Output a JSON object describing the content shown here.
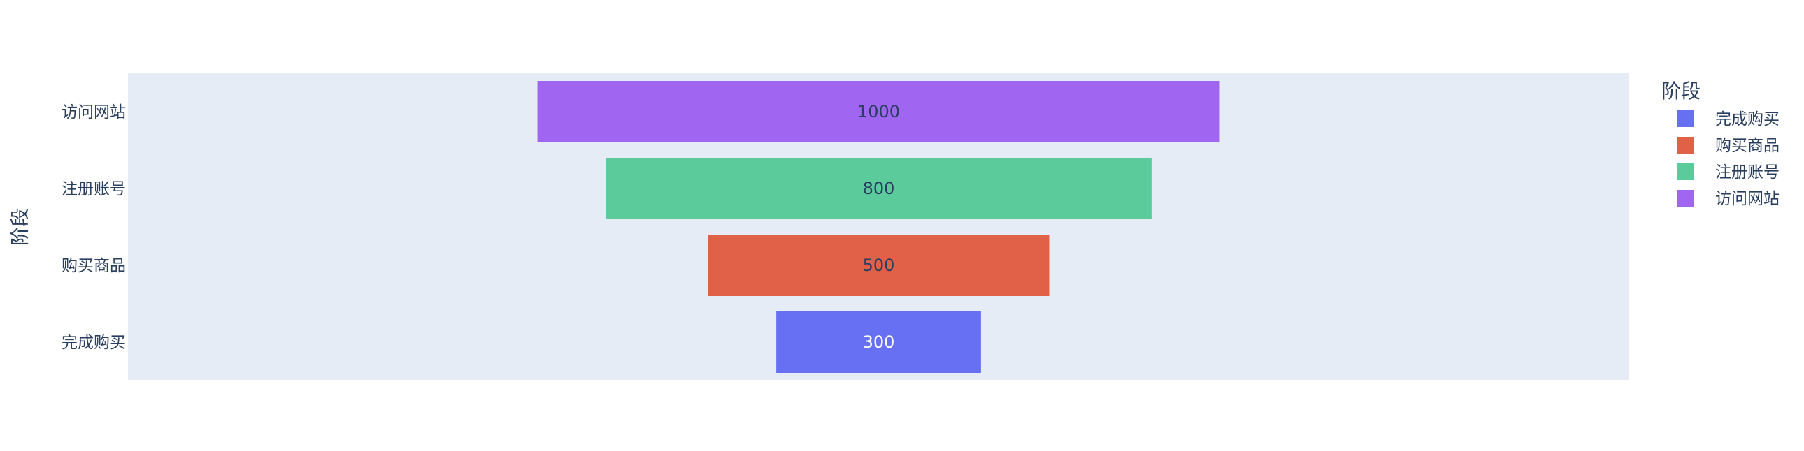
{
  "chart_data": {
    "type": "funnel",
    "ylabel": "阶段",
    "categories": [
      "访问网站",
      "注册账号",
      "购买商品",
      "完成购买"
    ],
    "values": [
      1000,
      800,
      500,
      300
    ],
    "colors": [
      "#a066f2",
      "#5ccb9c",
      "#e06148",
      "#6770f2"
    ],
    "label_colors": [
      "#2a3f5f",
      "#2a3f5f",
      "#2a3f5f",
      "#ffffff"
    ],
    "xlim": [
      -1100,
      1100
    ],
    "legend": {
      "title": "阶段",
      "position": "top-right",
      "items": [
        {
          "label": "完成购买",
          "color": "#6770f2"
        },
        {
          "label": "购买商品",
          "color": "#e06148"
        },
        {
          "label": "注册账号",
          "color": "#5ccb9c"
        },
        {
          "label": "访问网站",
          "color": "#a066f2"
        }
      ]
    },
    "plot_background": "#e5ecf6"
  }
}
